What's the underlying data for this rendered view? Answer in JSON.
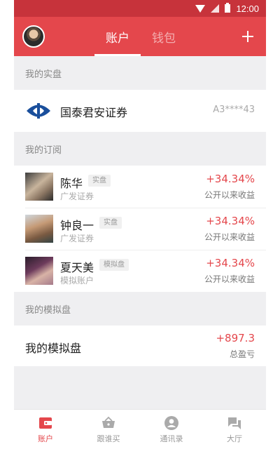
{
  "status": {
    "time": "12:00"
  },
  "header": {
    "tabs": [
      {
        "label": "账户",
        "active": true
      },
      {
        "label": "钱包",
        "active": false
      }
    ]
  },
  "sections": {
    "real": "我的实盘",
    "subscriptions": "我的订阅",
    "simulated": "我的模拟盘"
  },
  "broker": {
    "name": "国泰君安证券",
    "account": "A3****43"
  },
  "subscriptions": [
    {
      "name": "陈华",
      "tag": "实盘",
      "sub": "广发证券",
      "return": "+34.34%",
      "return_label": "公开以来收益"
    },
    {
      "name": "钟良一",
      "tag": "实盘",
      "sub": "广发证券",
      "return": "+34.34%",
      "return_label": "公开以来收益"
    },
    {
      "name": "夏天美",
      "tag": "模拟盘",
      "sub": "模拟账户",
      "return": "+34.34%",
      "return_label": "公开以来收益"
    }
  ],
  "simulated": {
    "name": "我的模拟盘",
    "value": "+897.3",
    "label": "总盈亏"
  },
  "bottom_nav": [
    {
      "label": "账户",
      "icon": "wallet-icon",
      "active": true
    },
    {
      "label": "跟谁买",
      "icon": "basket-icon",
      "active": false
    },
    {
      "label": "通讯录",
      "icon": "contact-icon",
      "active": false
    },
    {
      "label": "大厅",
      "icon": "chat-icon",
      "active": false
    }
  ],
  "colors": {
    "accent": "#e4474c",
    "statusbar": "#c7333b",
    "background": "#efeff1"
  }
}
